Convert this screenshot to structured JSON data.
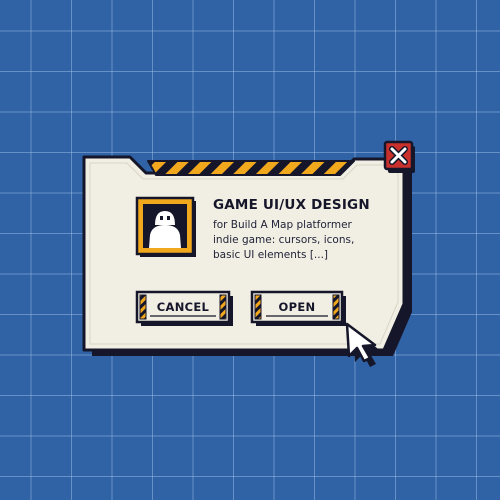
{
  "dialog": {
    "title": "GAME UI/UX DESIGN",
    "description_lines": [
      "for Build A Map platformer",
      "indie game: cursors, icons,",
      "basic UI elements [...]"
    ],
    "avatar_icon": "robot-avatar-icon",
    "close_icon": "close-x-icon"
  },
  "buttons": {
    "cancel_label": "CANCEL",
    "open_label": "OPEN"
  },
  "cursor_icon": "arrow-cursor-icon",
  "colors": {
    "background": "#2f63a6",
    "panel": "#f1efe3",
    "outline": "#16162a",
    "accent_yellow": "#f2a81d",
    "close_red": "#c9302c"
  }
}
